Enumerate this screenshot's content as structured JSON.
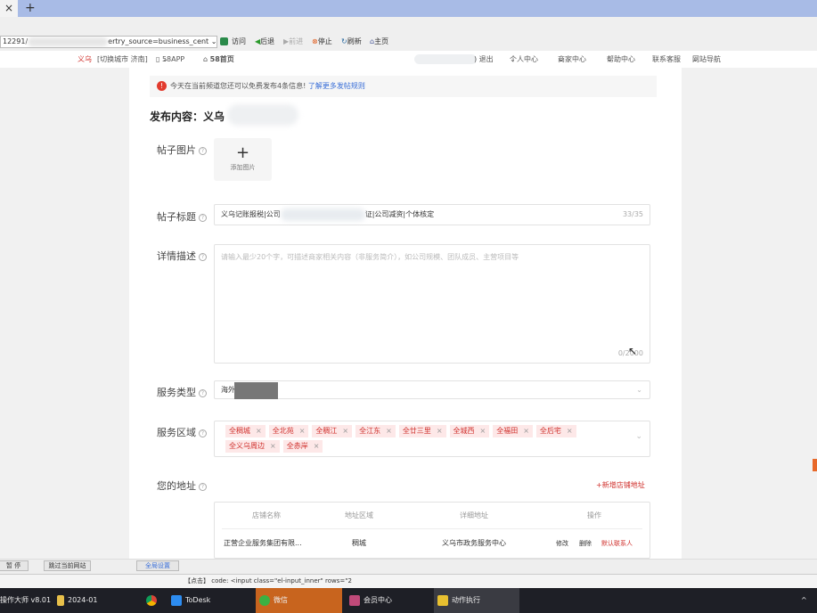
{
  "browser": {
    "tab_close": "×",
    "new_tab": "+",
    "url_prefix": "12291/",
    "url_suffix": "ertry_source=business_cent",
    "visit": "访问",
    "back": "后退",
    "forward": "前进",
    "stop": "停止",
    "refresh": "刷新",
    "home": "主页"
  },
  "site_nav": {
    "city": "义乌",
    "switch_city": "[切换城市 济南]",
    "app": "58APP",
    "home": "58首页",
    "logout": ") 退出",
    "items": [
      "个人中心",
      "商家中心",
      "帮助中心",
      "联系客服",
      "网站导航"
    ]
  },
  "notice": {
    "text": "今天在当前频道您还可以免费发布4条信息!",
    "link": "了解更多发帖规则"
  },
  "form": {
    "heading": "发布内容：义乌",
    "image_label": "帖子图片",
    "add_image": "添加图片",
    "title_label": "帖子标题",
    "title_value_start": "义乌记账报税|公司",
    "title_value_end": "证|公司减资|个体核定",
    "title_count": "33/35",
    "desc_label": "详情描述",
    "desc_placeholder": "请输入最少20个字，可描述商家相关内容（非服务简介），如公司规模、团队成员、主营项目等",
    "desc_count": "0/2000",
    "service_type_label": "服务类型",
    "service_type_value": "海外",
    "service_area_label": "服务区域",
    "service_areas": [
      "全稠城",
      "全北苑",
      "全稠江",
      "全江东",
      "全廿三里",
      "全城西",
      "全福田",
      "全后宅",
      "全义乌周边",
      "全赤岸"
    ],
    "address_label": "您的地址",
    "add_address": "+新增店铺地址",
    "address_table": {
      "headers": [
        "店铺名称",
        "地址区域",
        "详细地址",
        "操作"
      ],
      "rows": [
        {
          "name": "正营企业服务集团有限...",
          "area": "稠城",
          "detail": "义乌市政务服务中心",
          "actions": [
            "修改",
            "删除",
            "默认联系人"
          ]
        }
      ]
    }
  },
  "automation": {
    "pause": "暂 停",
    "skip": "跳过当前网站",
    "global_settings": "全局设置",
    "status": "【点击】 code:  <input class=\"el-input_inner\" rows=\"2"
  },
  "taskbar": {
    "items": [
      "操作大师 v8.01",
      "2024-01",
      "",
      "ToDesk",
      "微信",
      "会员中心",
      "动作执行"
    ],
    "tray": "^"
  },
  "colors": {
    "accent": "#d0312d",
    "link": "#3a6fd8",
    "tab_bar": "#a8bbe6",
    "wechat_active": "#c8641e"
  }
}
